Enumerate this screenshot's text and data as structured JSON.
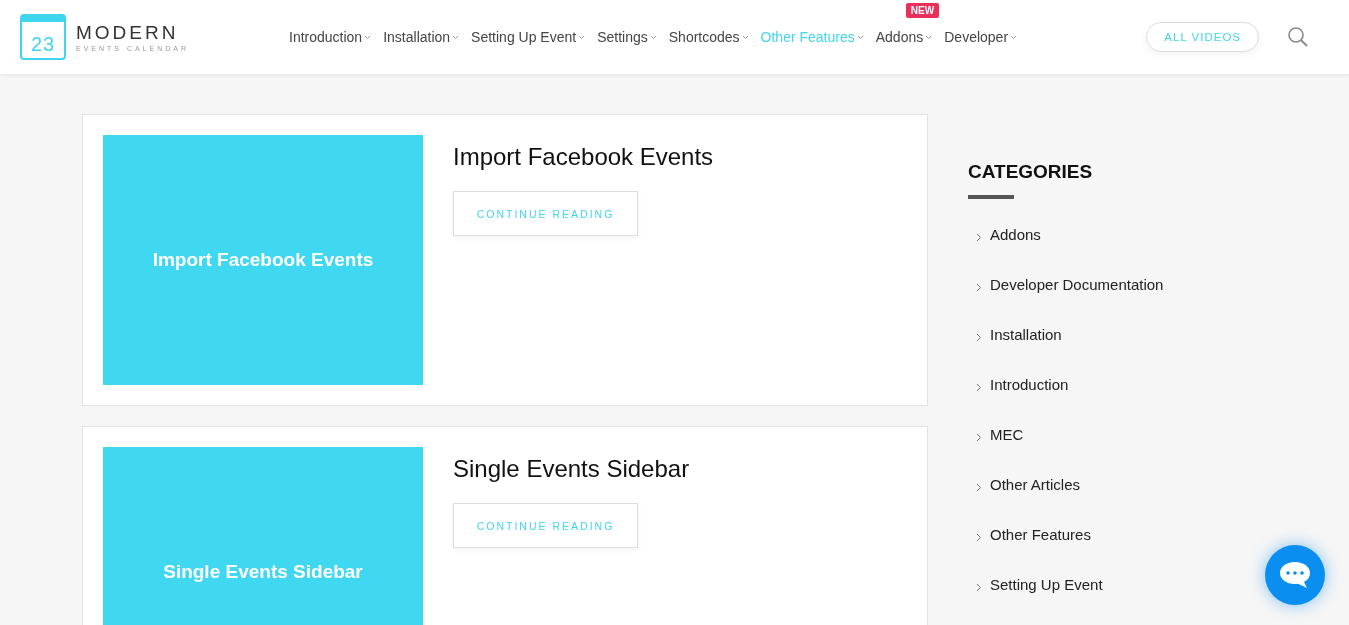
{
  "logo": {
    "number": "23",
    "name": "MODERN",
    "tagline": "EVENTS CALENDAR"
  },
  "nav": [
    {
      "label": "Introduction",
      "selected": false
    },
    {
      "label": "Installation",
      "selected": false
    },
    {
      "label": "Setting Up Event",
      "selected": false
    },
    {
      "label": "Settings",
      "selected": false
    },
    {
      "label": "Shortcodes",
      "selected": false
    },
    {
      "label": "Other Features",
      "selected": true
    },
    {
      "label": "Addons",
      "selected": false,
      "badge": "NEW"
    },
    {
      "label": "Developer",
      "selected": false
    }
  ],
  "all_videos_button": "ALL VIDEOS",
  "posts": [
    {
      "thumbnail_text": "Import Facebook Events",
      "title": "Import Facebook Events",
      "button": "CONTINUE READING"
    },
    {
      "thumbnail_text": "Single Events Sidebar",
      "title": "Single Events Sidebar",
      "button": "CONTINUE READING"
    }
  ],
  "sidebar": {
    "title": "CATEGORIES",
    "items": [
      "Addons",
      "Developer Documentation",
      "Installation",
      "Introduction",
      "MEC",
      "Other Articles",
      "Other Features",
      "Setting Up Event"
    ]
  }
}
